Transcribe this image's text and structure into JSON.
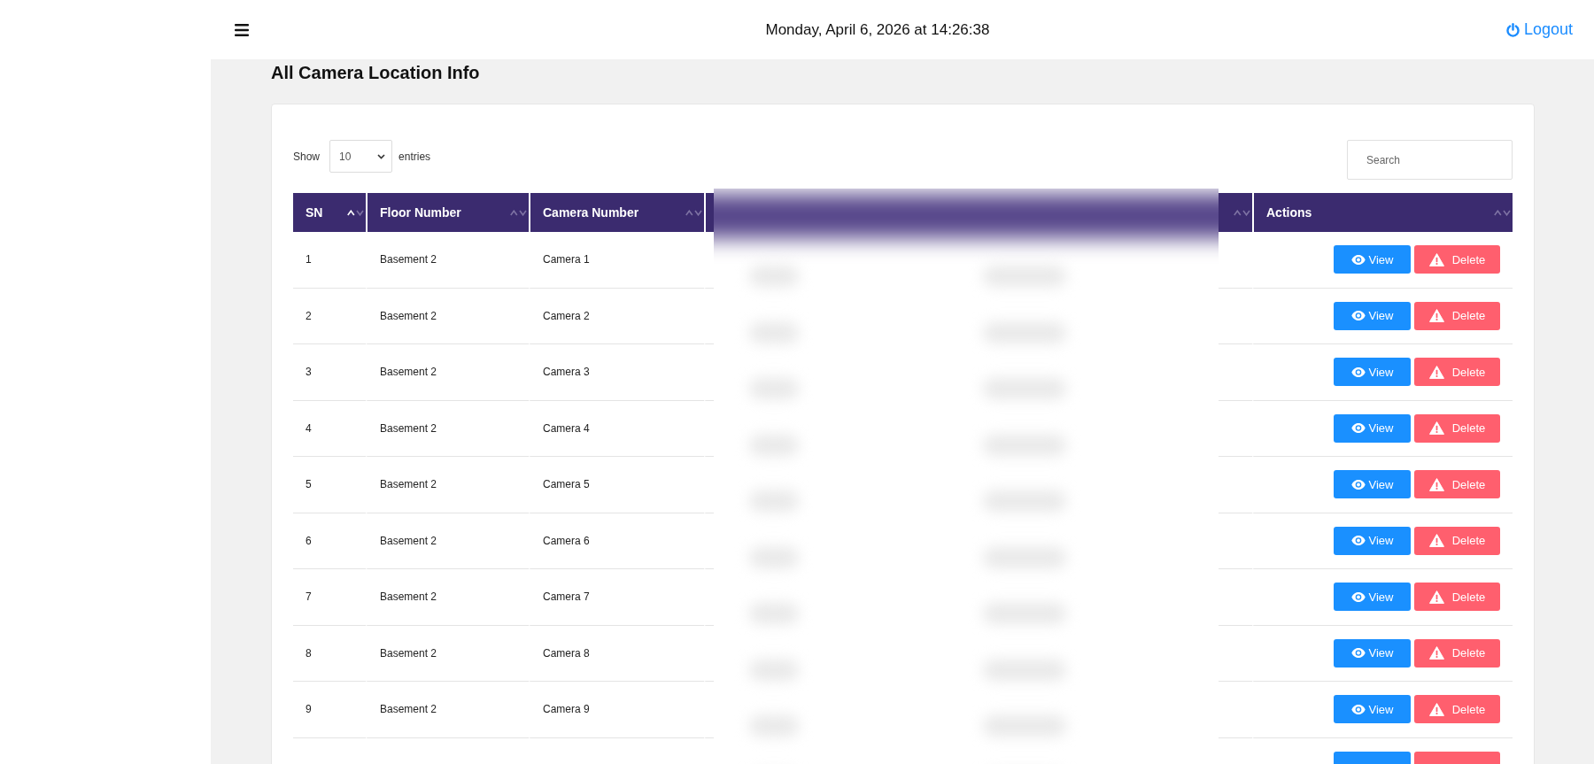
{
  "header": {
    "date_time": "Monday, April 6, 2026 at 14:26:38",
    "logout_label": "Logout"
  },
  "page": {
    "title": "All Camera Location Info"
  },
  "table_controls": {
    "show_label": "Show",
    "page_size": "10",
    "entries_label": "entries",
    "search": {
      "placeholder": "Search"
    }
  },
  "table": {
    "columns": [
      {
        "kind": "data",
        "label": "SN",
        "sorted": true
      },
      {
        "kind": "data",
        "label": "Floor Number",
        "sorted": false
      },
      {
        "kind": "data",
        "label": "Camera Number",
        "sorted": false
      },
      {
        "kind": "redacted"
      },
      {
        "kind": "redacted",
        "sorted": false
      },
      {
        "kind": "actions",
        "label": "Actions",
        "sorted": false
      }
    ],
    "rows": [
      {
        "cells": [
          "1",
          "Basement 2",
          "Camera 1"
        ],
        "actions": [
          {
            "kind": "view",
            "label": "View"
          },
          {
            "kind": "delete",
            "label": "Delete"
          }
        ]
      },
      {
        "cells": [
          "2",
          "Basement 2",
          "Camera 2"
        ],
        "actions": [
          {
            "kind": "view",
            "label": "View"
          },
          {
            "kind": "delete",
            "label": "Delete"
          }
        ]
      },
      {
        "cells": [
          "3",
          "Basement 2",
          "Camera 3"
        ],
        "actions": [
          {
            "kind": "view",
            "label": "View"
          },
          {
            "kind": "delete",
            "label": "Delete"
          }
        ]
      },
      {
        "cells": [
          "4",
          "Basement 2",
          "Camera 4"
        ],
        "actions": [
          {
            "kind": "view",
            "label": "View"
          },
          {
            "kind": "delete",
            "label": "Delete"
          }
        ]
      },
      {
        "cells": [
          "5",
          "Basement 2",
          "Camera 5"
        ],
        "actions": [
          {
            "kind": "view",
            "label": "View"
          },
          {
            "kind": "delete",
            "label": "Delete"
          }
        ]
      },
      {
        "cells": [
          "6",
          "Basement 2",
          "Camera 6"
        ],
        "actions": [
          {
            "kind": "view",
            "label": "View"
          },
          {
            "kind": "delete",
            "label": "Delete"
          }
        ]
      },
      {
        "cells": [
          "7",
          "Basement 2",
          "Camera 7"
        ],
        "actions": [
          {
            "kind": "view",
            "label": "View"
          },
          {
            "kind": "delete",
            "label": "Delete"
          }
        ]
      },
      {
        "cells": [
          "8",
          "Basement 2",
          "Camera 8"
        ],
        "actions": [
          {
            "kind": "view",
            "label": "View"
          },
          {
            "kind": "delete",
            "label": "Delete"
          }
        ]
      },
      {
        "cells": [
          "9",
          "Basement 2",
          "Camera 9"
        ],
        "actions": [
          {
            "kind": "view",
            "label": "View"
          },
          {
            "kind": "delete",
            "label": "Delete"
          }
        ]
      },
      {
        "actions": [
          {
            "kind": "view"
          },
          {
            "kind": "delete"
          }
        ]
      }
    ]
  }
}
